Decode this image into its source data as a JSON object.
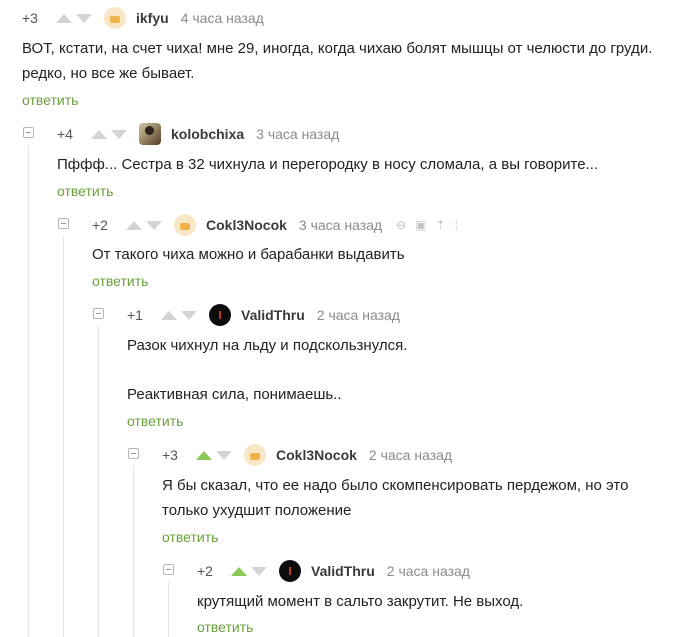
{
  "reply_label": "ответить",
  "comments": [
    {
      "rating": "+3",
      "upvoted": false,
      "avatar": "default-avatar",
      "author": "ikfyu",
      "time": "4 часа назад",
      "text": "ВОТ, кстати, на счет чиха! мне 29, иногда, когда чихаю болят мышцы от челюсти до груди. редко, но все же бывает."
    },
    {
      "rating": "+4",
      "upvoted": false,
      "avatar": "photo-avatar",
      "author": "kolobchixa",
      "time": "3 часа назад",
      "text": "Пффф... Сестра в 32 чихнула и перегородку в носу сломала, а вы говорите..."
    },
    {
      "rating": "+2",
      "upvoted": false,
      "avatar": "default-avatar",
      "author": "Cokl3Nocok",
      "time": "3 часа назад",
      "tool_icons": [
        "link-icon",
        "save-icon",
        "share-icon",
        "more-icon"
      ],
      "text": "От такого чиха можно и барабанки выдавить"
    },
    {
      "rating": "+1",
      "upvoted": false,
      "avatar": "dark-avatar",
      "author": "ValidThru",
      "time": "2 часа назад",
      "text_line1": "Разок чихнул на льду и подскользнулся.",
      "text_line2": "Реактивная сила, понимаешь.."
    },
    {
      "rating": "+3",
      "upvoted": true,
      "avatar": "default-avatar",
      "author": "Cokl3Nocok",
      "time": "2 часа назад",
      "text": "Я бы сказал, что ее надо было скомпенсировать пердежом, но это только ухудшит положение"
    },
    {
      "rating": "+2",
      "upvoted": true,
      "avatar": "dark-avatar",
      "author": "ValidThru",
      "time": "2 часа назад",
      "text": "крутящий момент в сальто закрутит. Не выход."
    }
  ]
}
